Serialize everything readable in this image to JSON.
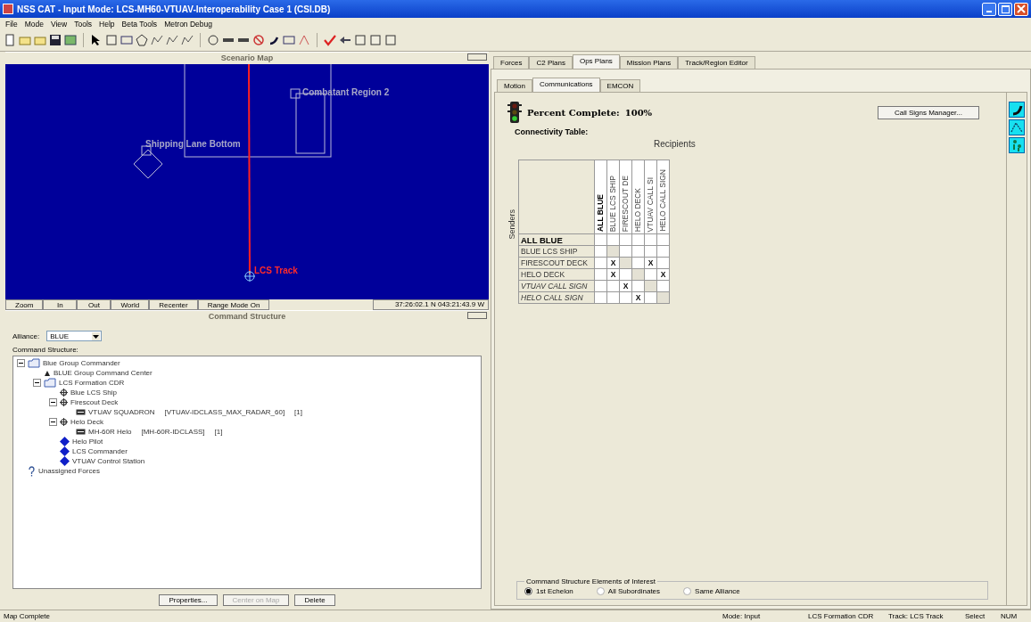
{
  "window": {
    "title": "NSS CAT - Input Mode: LCS-MH60-VTUAV-Interoperability Case 1 (CSI.DB)"
  },
  "menu": [
    "File",
    "Mode",
    "View",
    "Tools",
    "Help",
    "Beta Tools",
    "Metron Debug"
  ],
  "scenario_map": {
    "title": "Scenario Map",
    "labels": [
      {
        "kind": "region",
        "text": "Combatant Region 2"
      },
      {
        "kind": "region",
        "text": "Shipping Lane Bottom"
      },
      {
        "kind": "track",
        "text": "LCS Track"
      }
    ],
    "buttons": [
      "Zoom",
      "In",
      "Out",
      "World",
      "Recenter",
      "Range Mode On"
    ],
    "coordinates": "37:26:02.1 N 043:21:43.9 W"
  },
  "command_structure": {
    "title": "Command Structure",
    "alliance_label": "Alliance:",
    "alliance": "BLUE",
    "tree_label": "Command Structure:",
    "tree": [
      {
        "kind": "folder",
        "label": "Blue Group Commander",
        "expanded": true,
        "children": [
          {
            "kind": "triangle",
            "label": "BLUE Group Command Center"
          },
          {
            "kind": "folder",
            "label": "LCS Formation CDR",
            "expanded": true,
            "children": [
              {
                "kind": "gear",
                "label": "Blue LCS Ship"
              },
              {
                "kind": "gear",
                "label": "Firescout Deck",
                "expanded": true,
                "children": [
                  {
                    "kind": "unit",
                    "label": "VTUAV SQUADRON",
                    "extra": [
                      "[VTUAV-IDCLASS_MAX_RADAR_60]",
                      "[1]"
                    ]
                  }
                ]
              },
              {
                "kind": "gear",
                "label": "Helo Deck",
                "expanded": true,
                "children": [
                  {
                    "kind": "unit",
                    "label": "MH-60R Helo",
                    "extra": [
                      "[MH-60R-IDCLASS]",
                      "[1]"
                    ]
                  }
                ]
              },
              {
                "kind": "diamond",
                "label": "Helo Pilot"
              },
              {
                "kind": "diamond",
                "label": "LCS Commander"
              },
              {
                "kind": "diamond",
                "label": "VTUAV Control Station"
              }
            ]
          }
        ]
      },
      {
        "kind": "question",
        "label": "Unassigned Forces"
      }
    ],
    "buttons": [
      {
        "label": "Properties...",
        "disabled": false
      },
      {
        "label": "Center on Map",
        "disabled": true
      },
      {
        "label": "Delete",
        "disabled": false
      }
    ]
  },
  "tabs": [
    {
      "label": "Forces",
      "selected": false
    },
    {
      "label": "C2 Plans",
      "selected": false
    },
    {
      "label": "Ops Plans",
      "selected": true
    },
    {
      "label": "Mission Plans",
      "selected": false
    },
    {
      "label": "Track/Region Editor",
      "selected": false
    }
  ],
  "subtabs": [
    {
      "label": "Motion",
      "selected": false
    },
    {
      "label": "Communications",
      "selected": true
    },
    {
      "label": "EMCON",
      "selected": false
    }
  ],
  "percent_complete": {
    "label": "Percent Complete:",
    "value": "100%"
  },
  "call_signs_button": "Call Signs Manager...",
  "connectivity": {
    "title": "Connectivity Table:",
    "recipients_label": "Recipients",
    "senders_label": "Senders",
    "columns": [
      "ALL BLUE",
      "BLUE LCS SHIP",
      "FIRESCOUT DE",
      "HELO DECK",
      "VTUAV CALL SI",
      "HELO CALL SIGN"
    ],
    "rows": [
      {
        "label": "ALL BLUE",
        "kind": "group",
        "cells": [
          null,
          null,
          null,
          null,
          null,
          null
        ]
      },
      {
        "label": "BLUE LCS SHIP",
        "kind": "platform",
        "cells": [
          null,
          null,
          null,
          null,
          null,
          null
        ]
      },
      {
        "label": "FIRESCOUT DECK",
        "kind": "platform",
        "cells": [
          null,
          "X",
          null,
          null,
          "X",
          null
        ]
      },
      {
        "label": "HELO DECK",
        "kind": "platform",
        "cells": [
          null,
          "X",
          null,
          null,
          null,
          "X"
        ]
      },
      {
        "label": "VTUAV CALL SIGN",
        "kind": "callsign",
        "cells": [
          null,
          null,
          "X",
          null,
          null,
          null
        ]
      },
      {
        "label": "HELO CALL SIGN",
        "kind": "callsign",
        "cells": [
          null,
          null,
          null,
          "X",
          null,
          null
        ]
      }
    ]
  },
  "elements_of_interest": {
    "title": "Command Structure Elements of Interest",
    "options": [
      {
        "label": "1st Echelon",
        "selected": true
      },
      {
        "label": "All Subordinates",
        "selected": false
      },
      {
        "label": "Same Alliance",
        "selected": false
      }
    ]
  },
  "status_bar": [
    "Map Complete",
    "Mode: Input",
    "LCS Formation CDR",
    "Track: LCS Track",
    "Select",
    "NUM"
  ]
}
